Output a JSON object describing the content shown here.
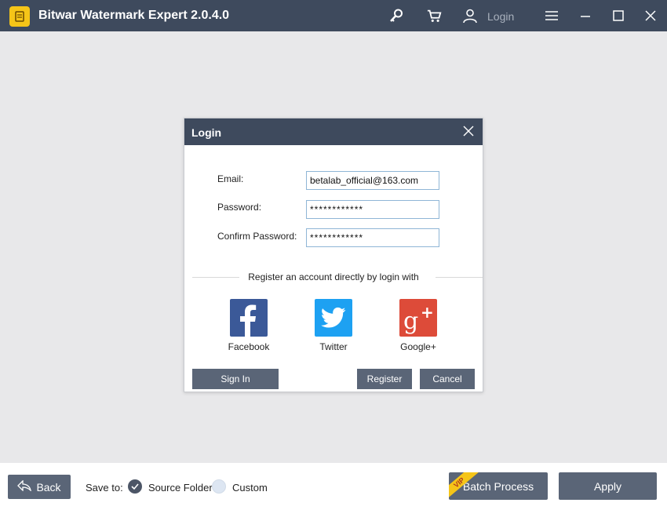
{
  "app": {
    "title": "Bitwar Watermark Expert  2.0.4.0",
    "login_label": "Login"
  },
  "dialog": {
    "title": "Login",
    "email_label": "Email:",
    "email_value": "betalab_official@163.com",
    "password_label": "Password:",
    "password_value": "************",
    "confirm_label": "Confirm Password:",
    "confirm_value": "************",
    "divider_text": "Register an account directly by login with",
    "social": [
      {
        "label": "Facebook",
        "icon": "facebook-icon",
        "color": "#3b5998"
      },
      {
        "label": "Twitter",
        "icon": "twitter-icon",
        "color": "#1da1f2"
      },
      {
        "label": "Google+",
        "icon": "google-plus-icon",
        "color": "#dd4b39"
      }
    ],
    "sign_in_label": "Sign In",
    "register_label": "Register",
    "cancel_label": "Cancel"
  },
  "bottom": {
    "back_label": "Back",
    "save_to_label": "Save to:",
    "source_folder_label": "Source Folder",
    "custom_label": "Custom",
    "selected": "Source Folder",
    "vip_badge": "VIP",
    "batch_label": "Batch Process",
    "apply_label": "Apply"
  },
  "colors": {
    "titlebar": "#3e4a5d",
    "button": "#5a6577",
    "accent_logo": "#f5c518"
  }
}
